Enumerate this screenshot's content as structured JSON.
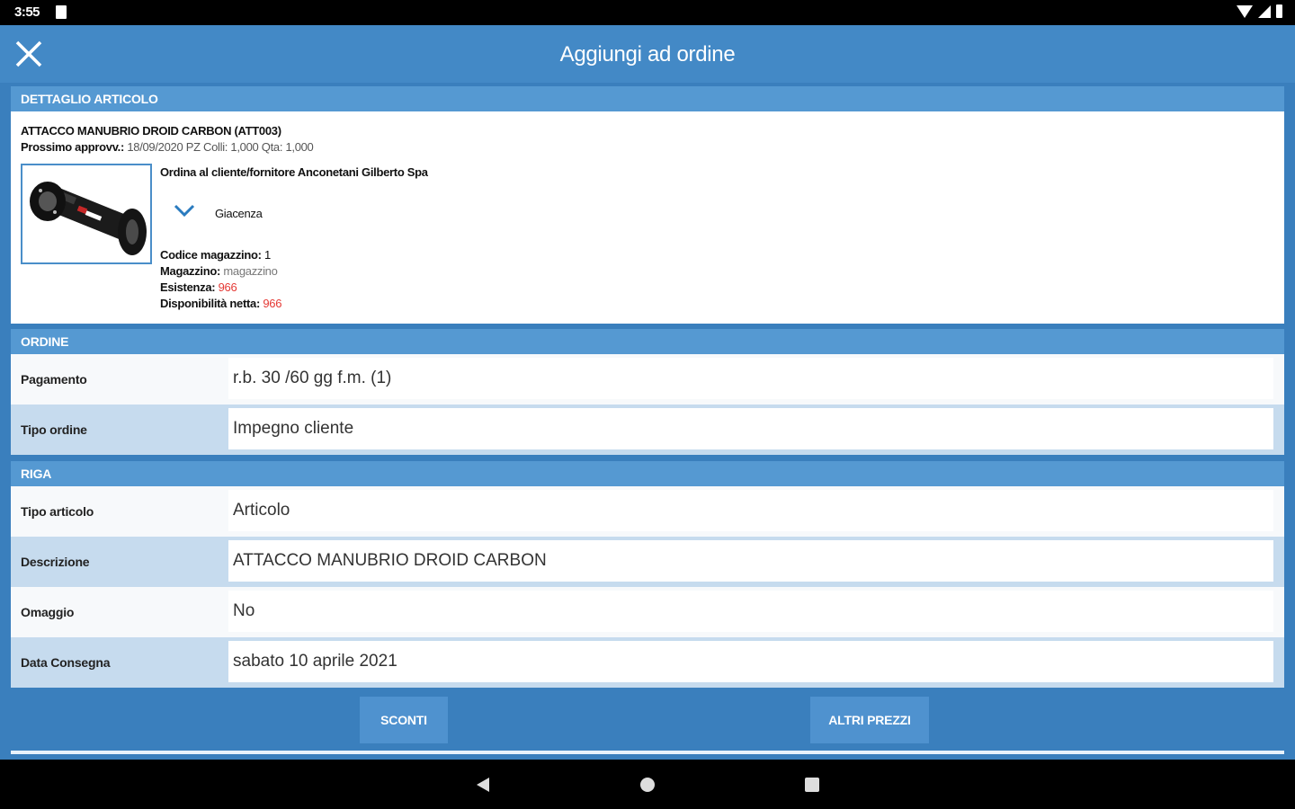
{
  "status_bar": {
    "time": "3:55"
  },
  "app_bar": {
    "title": "Aggiungi ad ordine"
  },
  "detail": {
    "section_title": "DETTAGLIO ARTICOLO",
    "article_title": "ATTACCO MANUBRIO DROID CARBON (ATT003)",
    "next_supply_label": "Prossimo approvv.:",
    "next_supply_value": "18/09/2020 PZ Colli: 1,000 Qta: 1,000",
    "order_to": "Ordina al cliente/fornitore Anconetani Gilberto Spa",
    "stock_toggle_label": "Giacenza",
    "warehouse_code_label": "Codice magazzino:",
    "warehouse_code_value": "1",
    "warehouse_label": "Magazzino:",
    "warehouse_value": "magazzino",
    "existence_label": "Esistenza:",
    "existence_value": "966",
    "availability_label": "Disponibilità netta:",
    "availability_value": "966"
  },
  "order": {
    "section_title": "ORDINE",
    "rows": [
      {
        "label": "Pagamento",
        "value": "r.b. 30 /60 gg f.m. (1)"
      },
      {
        "label": "Tipo ordine",
        "value": "Impegno cliente"
      }
    ]
  },
  "line": {
    "section_title": "RIGA",
    "rows": [
      {
        "label": "Tipo articolo",
        "value": "Articolo"
      },
      {
        "label": "Descrizione",
        "value": "ATTACCO MANUBRIO DROID CARBON"
      },
      {
        "label": "Omaggio",
        "value": "No"
      },
      {
        "label": "Data Consegna",
        "value": "sabato 10 aprile 2021"
      }
    ]
  },
  "buttons": {
    "discounts": "SCONTI",
    "other_prices": "ALTRI PREZZI"
  },
  "colors": {
    "app_bar": "#4389c6",
    "section": "#5599d2",
    "row_alt": "#c6dbee",
    "stock_value": "#e53935"
  }
}
